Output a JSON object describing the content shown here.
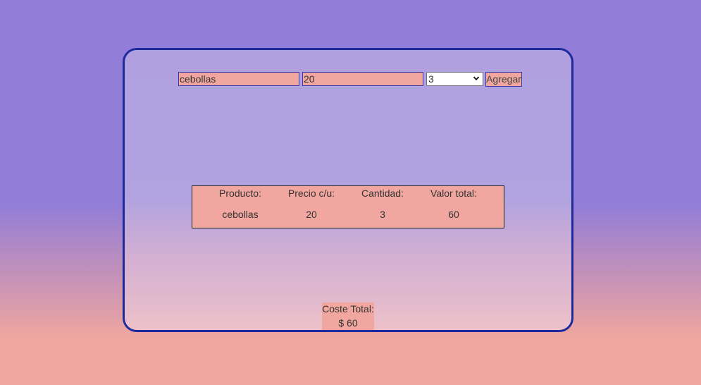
{
  "form": {
    "product_value": "cebollas",
    "price_value": "20",
    "quantity_selected": "3",
    "add_label": "Agregar"
  },
  "table": {
    "headers": [
      "Producto:",
      "Precio c/u:",
      "Cantidad:",
      "Valor total:"
    ],
    "rows": [
      [
        "cebollas",
        "20",
        "3",
        "60"
      ]
    ]
  },
  "total": {
    "label": "Coste Total:",
    "value": "$ 60"
  },
  "icons": {
    "select_arrow": "chevron-down-icon"
  },
  "colors": {
    "accent_border": "#1c2a9c",
    "field_fill": "#f1a7a0"
  }
}
